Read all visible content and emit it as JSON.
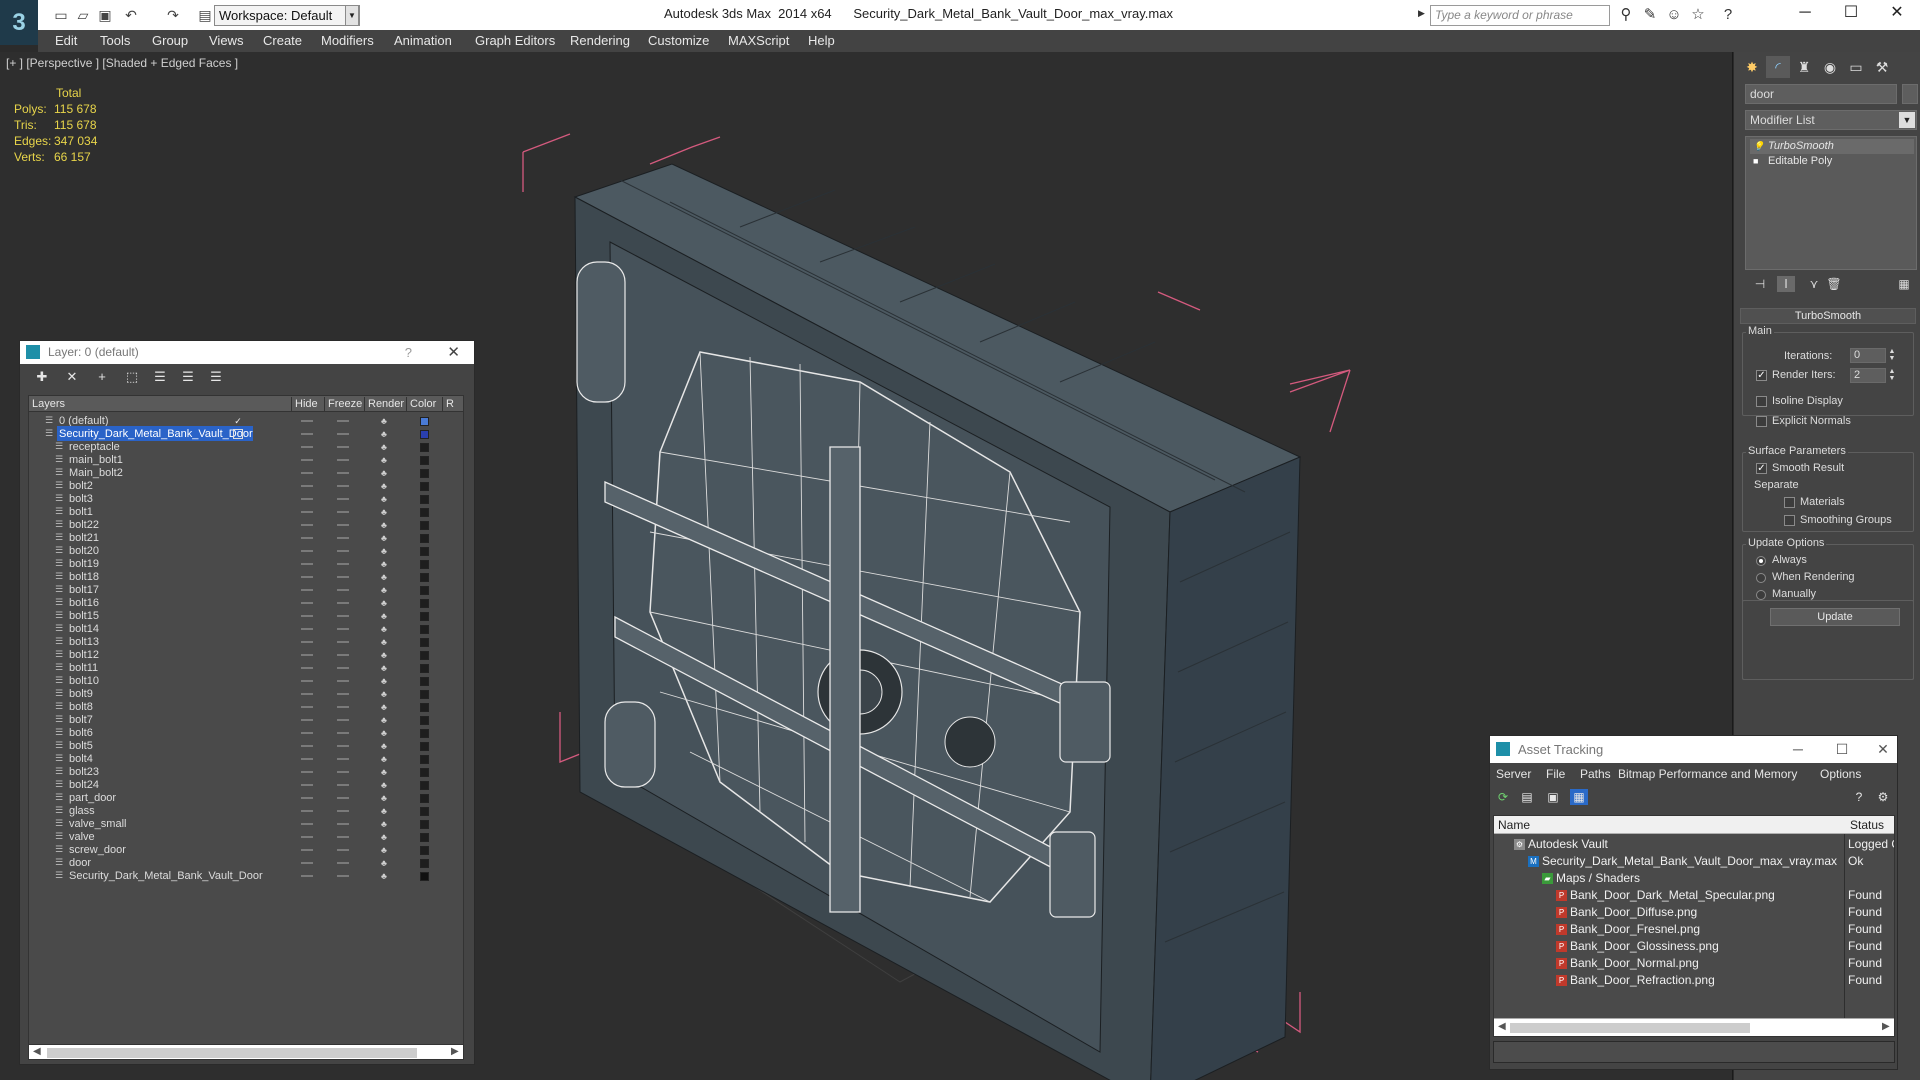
{
  "titlebar": {
    "workspace": "Workspace: Default",
    "app_title": "Autodesk 3ds Max  2014 x64",
    "file_title": "Security_Dark_Metal_Bank_Vault_Door_max_vray.max",
    "search_placeholder": "Type a keyword or phrase"
  },
  "menu": [
    "Edit",
    "Tools",
    "Group",
    "Views",
    "Create",
    "Modifiers",
    "Animation",
    "Graph Editors",
    "Rendering",
    "Customize",
    "MAXScript",
    "Help"
  ],
  "viewport": {
    "label": "[+ ] [Perspective ] [Shaded + Edged Faces ]",
    "stats": {
      "header": "Total",
      "rows": [
        {
          "key": "Polys:",
          "value": "115 678"
        },
        {
          "key": "Tris:",
          "value": "115 678"
        },
        {
          "key": "Edges:",
          "value": "347 034"
        },
        {
          "key": "Verts:",
          "value": "66 157"
        }
      ]
    }
  },
  "command_panel": {
    "object_name": "door",
    "modifier_list": "Modifier List",
    "stack": [
      "TurboSmooth",
      "Editable Poly"
    ],
    "turbosmooth": {
      "title": "TurboSmooth",
      "main_label": "Main",
      "iterations_label": "Iterations:",
      "iterations": "0",
      "render_iters_label": "Render Iters:",
      "render_iters": "2",
      "isoline": "Isoline Display",
      "explicit_normals": "Explicit Normals",
      "surface_params": "Surface Parameters",
      "smooth_result": "Smooth Result",
      "separate": "Separate",
      "materials": "Materials",
      "smoothing_groups": "Smoothing Groups",
      "update_options": "Update Options",
      "always": "Always",
      "when_rendering": "When Rendering",
      "manually": "Manually",
      "update_button": "Update"
    }
  },
  "layer_panel": {
    "title": "Layer: 0 (default)",
    "columns": [
      "Layers",
      "Hide",
      "Freeze",
      "Render",
      "Color",
      "R"
    ],
    "layers": [
      {
        "name": "0 (default)",
        "level": 0,
        "color": "#4a7bd6",
        "check": true
      },
      {
        "name": "Security_Dark_Metal_Bank_Vault_Door",
        "level": 0,
        "color": "#2a3fae",
        "selected": true
      },
      {
        "name": "receptacle",
        "level": 1,
        "color": "#1e1e1e"
      },
      {
        "name": "main_bolt1",
        "level": 1,
        "color": "#1e1e1e"
      },
      {
        "name": "Main_bolt2",
        "level": 1,
        "color": "#1e1e1e"
      },
      {
        "name": "bolt2",
        "level": 1,
        "color": "#1e1e1e"
      },
      {
        "name": "bolt3",
        "level": 1,
        "color": "#1e1e1e"
      },
      {
        "name": "bolt1",
        "level": 1,
        "color": "#1e1e1e"
      },
      {
        "name": "bolt22",
        "level": 1,
        "color": "#1e1e1e"
      },
      {
        "name": "bolt21",
        "level": 1,
        "color": "#1e1e1e"
      },
      {
        "name": "bolt20",
        "level": 1,
        "color": "#1e1e1e"
      },
      {
        "name": "bolt19",
        "level": 1,
        "color": "#1e1e1e"
      },
      {
        "name": "bolt18",
        "level": 1,
        "color": "#1e1e1e"
      },
      {
        "name": "bolt17",
        "level": 1,
        "color": "#1e1e1e"
      },
      {
        "name": "bolt16",
        "level": 1,
        "color": "#1e1e1e"
      },
      {
        "name": "bolt15",
        "level": 1,
        "color": "#1e1e1e"
      },
      {
        "name": "bolt14",
        "level": 1,
        "color": "#1e1e1e"
      },
      {
        "name": "bolt13",
        "level": 1,
        "color": "#1e1e1e"
      },
      {
        "name": "bolt12",
        "level": 1,
        "color": "#1e1e1e"
      },
      {
        "name": "bolt11",
        "level": 1,
        "color": "#1e1e1e"
      },
      {
        "name": "bolt10",
        "level": 1,
        "color": "#1e1e1e"
      },
      {
        "name": "bolt9",
        "level": 1,
        "color": "#1e1e1e"
      },
      {
        "name": "bolt8",
        "level": 1,
        "color": "#1e1e1e"
      },
      {
        "name": "bolt7",
        "level": 1,
        "color": "#1e1e1e"
      },
      {
        "name": "bolt6",
        "level": 1,
        "color": "#1e1e1e"
      },
      {
        "name": "bolt5",
        "level": 1,
        "color": "#1e1e1e"
      },
      {
        "name": "bolt4",
        "level": 1,
        "color": "#1e1e1e"
      },
      {
        "name": "bolt23",
        "level": 1,
        "color": "#1e1e1e"
      },
      {
        "name": "bolt24",
        "level": 1,
        "color": "#1e1e1e"
      },
      {
        "name": "part_door",
        "level": 1,
        "color": "#1e1e1e"
      },
      {
        "name": "glass",
        "level": 1,
        "color": "#1e1e1e"
      },
      {
        "name": "valve_small",
        "level": 1,
        "color": "#1e1e1e"
      },
      {
        "name": "valve",
        "level": 1,
        "color": "#1e1e1e"
      },
      {
        "name": "screw_door",
        "level": 1,
        "color": "#1e1e1e"
      },
      {
        "name": "door",
        "level": 1,
        "color": "#1e1e1e"
      },
      {
        "name": "Security_Dark_Metal_Bank_Vault_Door",
        "level": 1,
        "color": "#111111"
      }
    ]
  },
  "asset_panel": {
    "title": "Asset Tracking",
    "menu": [
      "Server",
      "File",
      "Paths",
      "Bitmap Performance and Memory",
      "Options"
    ],
    "columns": [
      "Name",
      "Status"
    ],
    "rows": [
      {
        "name": "Autodesk Vault",
        "status": "Logged O",
        "level": 0,
        "icon": "vault"
      },
      {
        "name": "Security_Dark_Metal_Bank_Vault_Door_max_vray.max",
        "status": "Ok",
        "level": 1,
        "icon": "max"
      },
      {
        "name": "Maps / Shaders",
        "status": "",
        "level": 2,
        "icon": "maps"
      },
      {
        "name": "Bank_Door_Dark_Metal_Specular.png",
        "status": "Found",
        "level": 3,
        "icon": "png"
      },
      {
        "name": "Bank_Door_Diffuse.png",
        "status": "Found",
        "level": 3,
        "icon": "png"
      },
      {
        "name": "Bank_Door_Fresnel.png",
        "status": "Found",
        "level": 3,
        "icon": "png"
      },
      {
        "name": "Bank_Door_Glossiness.png",
        "status": "Found",
        "level": 3,
        "icon": "png"
      },
      {
        "name": "Bank_Door_Normal.png",
        "status": "Found",
        "level": 3,
        "icon": "png"
      },
      {
        "name": "Bank_Door_Refraction.png",
        "status": "Found",
        "level": 3,
        "icon": "png"
      }
    ]
  }
}
